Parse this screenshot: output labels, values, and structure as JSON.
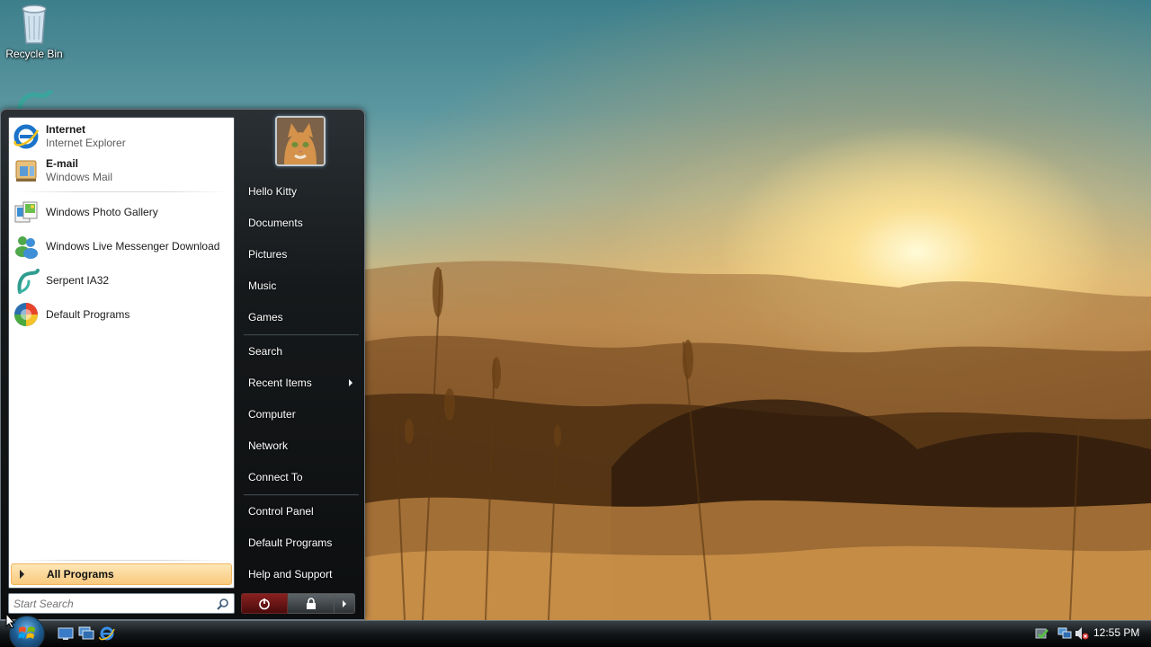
{
  "desktop": {
    "icons": [
      {
        "label": "Recycle Bin",
        "icon": "recycle-bin-icon"
      },
      {
        "label": "",
        "icon": "serpent-icon"
      }
    ]
  },
  "start_menu": {
    "pinned": [
      {
        "name": "Internet",
        "sub": "Internet Explorer",
        "icon": "internet-explorer-icon"
      },
      {
        "name": "E-mail",
        "sub": "Windows Mail",
        "icon": "windows-mail-icon"
      }
    ],
    "recent": [
      {
        "name": "Windows Photo Gallery",
        "icon": "photo-gallery-icon"
      },
      {
        "name": "Windows Live Messenger Download",
        "icon": "messenger-icon"
      },
      {
        "name": "Serpent IA32",
        "icon": "serpent-icon"
      },
      {
        "name": "Default Programs",
        "icon": "default-programs-icon"
      }
    ],
    "all_programs": "All Programs",
    "search_placeholder": "Start Search",
    "user_name": "Hello Kitty",
    "right_items": [
      {
        "label": "Documents"
      },
      {
        "label": "Pictures"
      },
      {
        "label": "Music"
      },
      {
        "label": "Games"
      },
      {
        "label": "Search"
      },
      {
        "label": "Recent Items"
      },
      {
        "label": "Computer"
      },
      {
        "label": "Network"
      },
      {
        "label": "Connect To"
      },
      {
        "label": "Control Panel"
      },
      {
        "label": "Default Programs"
      },
      {
        "label": "Help and Support"
      }
    ],
    "power_buttons": [
      "power-icon",
      "lock-icon",
      "arrow-right-icon"
    ]
  },
  "taskbar": {
    "quick_launch": [
      "show-desktop-icon",
      "switch-windows-icon",
      "internet-explorer-icon"
    ],
    "tray_icons": [
      "windows-defender-icon",
      "network-icon",
      "volume-muted-icon"
    ],
    "clock": "12:55 PM"
  },
  "colors": {
    "accent_all_programs": "#f9c97d",
    "menu_dark": "#16191b",
    "power_red": "#8a2020"
  }
}
